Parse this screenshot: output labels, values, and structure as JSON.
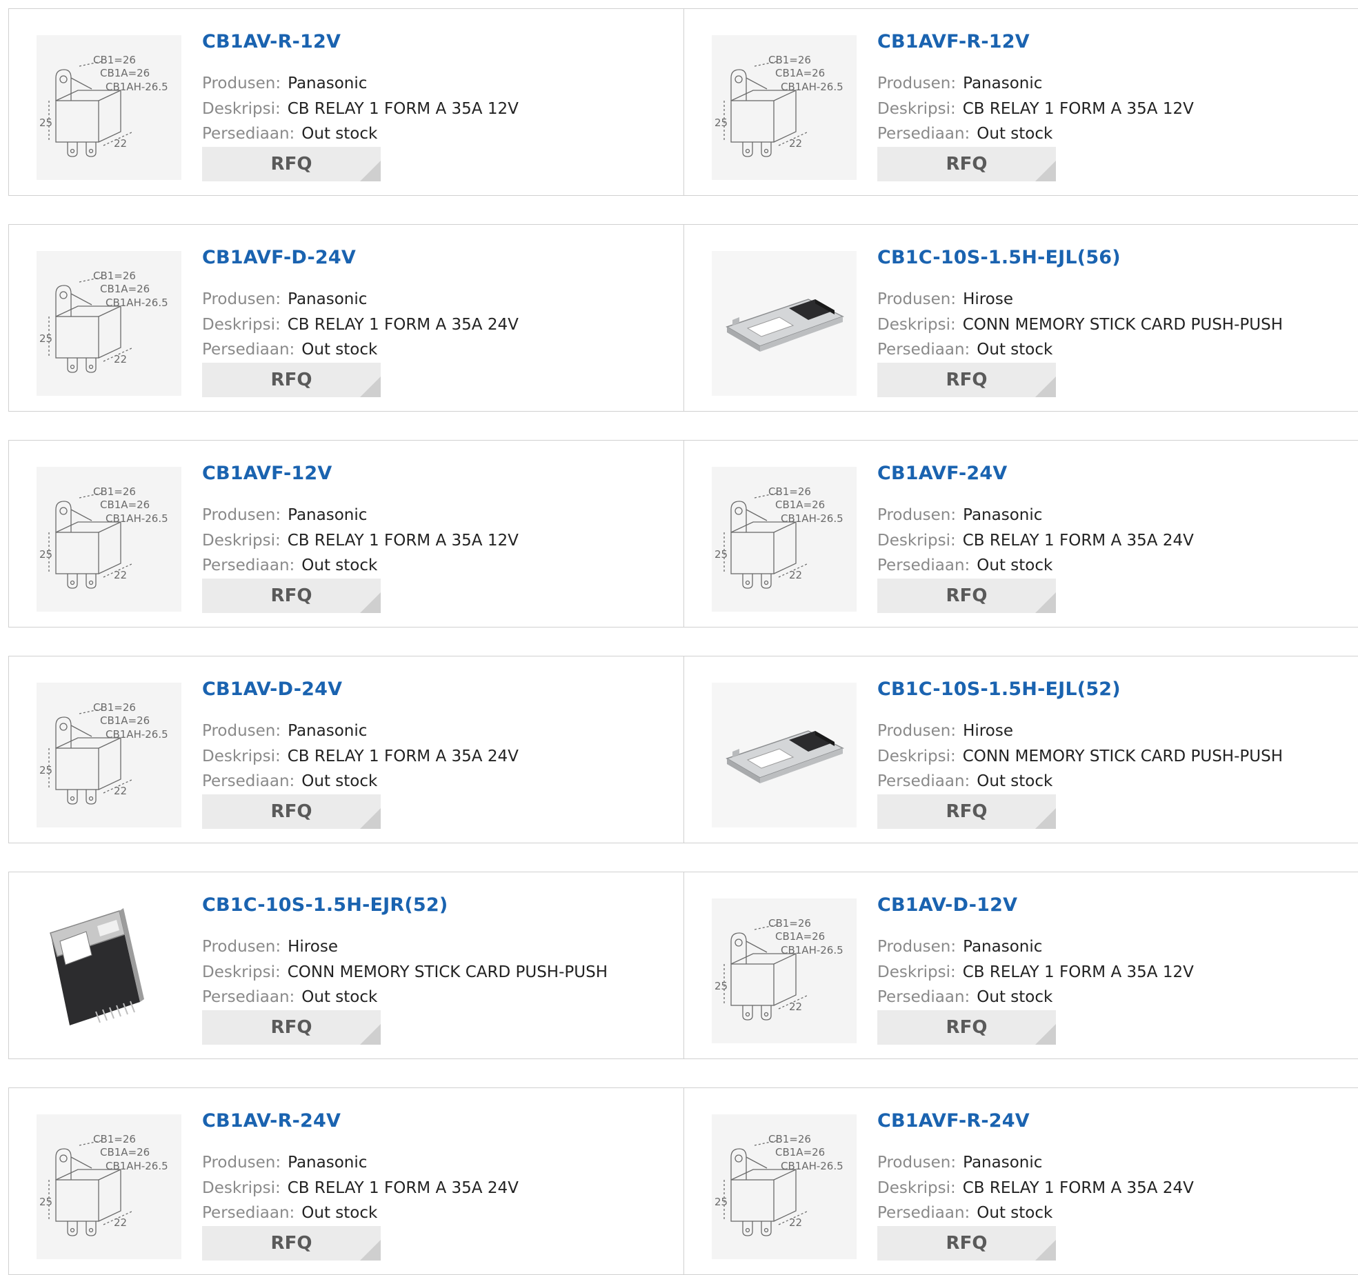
{
  "labels": {
    "manufacturer": "Produsen:",
    "description": "Deskripsi:",
    "stock": "Persediaan:",
    "rfq": "RFQ"
  },
  "relay_drawing_text": [
    "CB1=26",
    "CB1A=26",
    "CB1AH-26.5",
    "25",
    "22"
  ],
  "products": [
    {
      "name": "CB1AV-R-12V",
      "manufacturer": "Panasonic",
      "description": "CB RELAY 1 FORM A 35A 12V",
      "stock": "Out stock",
      "image": "relay-drawing"
    },
    {
      "name": "CB1AVF-R-12V",
      "manufacturer": "Panasonic",
      "description": "CB RELAY 1 FORM A 35A 12V",
      "stock": "Out stock",
      "image": "relay-drawing"
    },
    {
      "name": "CB1AVF-D-24V",
      "manufacturer": "Panasonic",
      "description": "CB RELAY 1 FORM A 35A 24V",
      "stock": "Out stock",
      "image": "relay-drawing"
    },
    {
      "name": "CB1C-10S-1.5H-EJL(56)",
      "manufacturer": "Hirose",
      "description": "CONN MEMORY STICK CARD PUSH-PUSH",
      "stock": "Out stock",
      "image": "card-connector-flat"
    },
    {
      "name": "CB1AVF-12V",
      "manufacturer": "Panasonic",
      "description": "CB RELAY 1 FORM A 35A 12V",
      "stock": "Out stock",
      "image": "relay-drawing"
    },
    {
      "name": "CB1AVF-24V",
      "manufacturer": "Panasonic",
      "description": "CB RELAY 1 FORM A 35A 24V",
      "stock": "Out stock",
      "image": "relay-drawing"
    },
    {
      "name": "CB1AV-D-24V",
      "manufacturer": "Panasonic",
      "description": "CB RELAY 1 FORM A 35A 24V",
      "stock": "Out stock",
      "image": "relay-drawing"
    },
    {
      "name": "CB1C-10S-1.5H-EJL(52)",
      "manufacturer": "Hirose",
      "description": "CONN MEMORY STICK CARD PUSH-PUSH",
      "stock": "Out stock",
      "image": "card-connector-flat"
    },
    {
      "name": "CB1C-10S-1.5H-EJR(52)",
      "manufacturer": "Hirose",
      "description": "CONN MEMORY STICK CARD PUSH-PUSH",
      "stock": "Out stock",
      "image": "card-connector-dark"
    },
    {
      "name": "CB1AV-D-12V",
      "manufacturer": "Panasonic",
      "description": "CB RELAY 1 FORM A 35A 12V",
      "stock": "Out stock",
      "image": "relay-drawing"
    },
    {
      "name": "CB1AV-R-24V",
      "manufacturer": "Panasonic",
      "description": "CB RELAY 1 FORM A 35A 24V",
      "stock": "Out stock",
      "image": "relay-drawing"
    },
    {
      "name": "CB1AVF-R-24V",
      "manufacturer": "Panasonic",
      "description": "CB RELAY 1 FORM A 35A 24V",
      "stock": "Out stock",
      "image": "relay-drawing"
    }
  ],
  "colors": {
    "link": "#1a63b0",
    "label": "#8a8a8a",
    "value": "#222222",
    "button_bg": "#ebebeb",
    "button_text": "#5a5a5a",
    "border": "#d0d0d0"
  }
}
